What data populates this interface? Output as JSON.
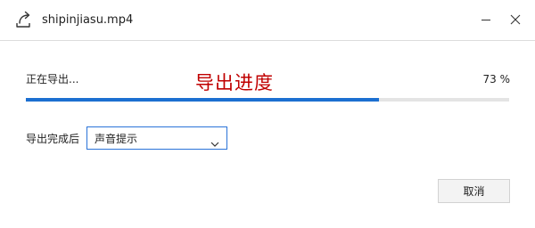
{
  "window": {
    "title": "shipinjiasu.mp4",
    "app_icon": "export-share-arrow-icon",
    "minimize_icon": "minimize-icon",
    "close_icon": "close-icon"
  },
  "export": {
    "status_text": "正在导出...",
    "progress_caption": "导出进度",
    "progress_percent_text": "73 %",
    "progress_value": 0.73,
    "progress_color": "#1c6fd1",
    "caption_color": "#c00000"
  },
  "after_export": {
    "label": "导出完成后",
    "selected_option": "声音提示"
  },
  "actions": {
    "cancel_label": "取消"
  }
}
